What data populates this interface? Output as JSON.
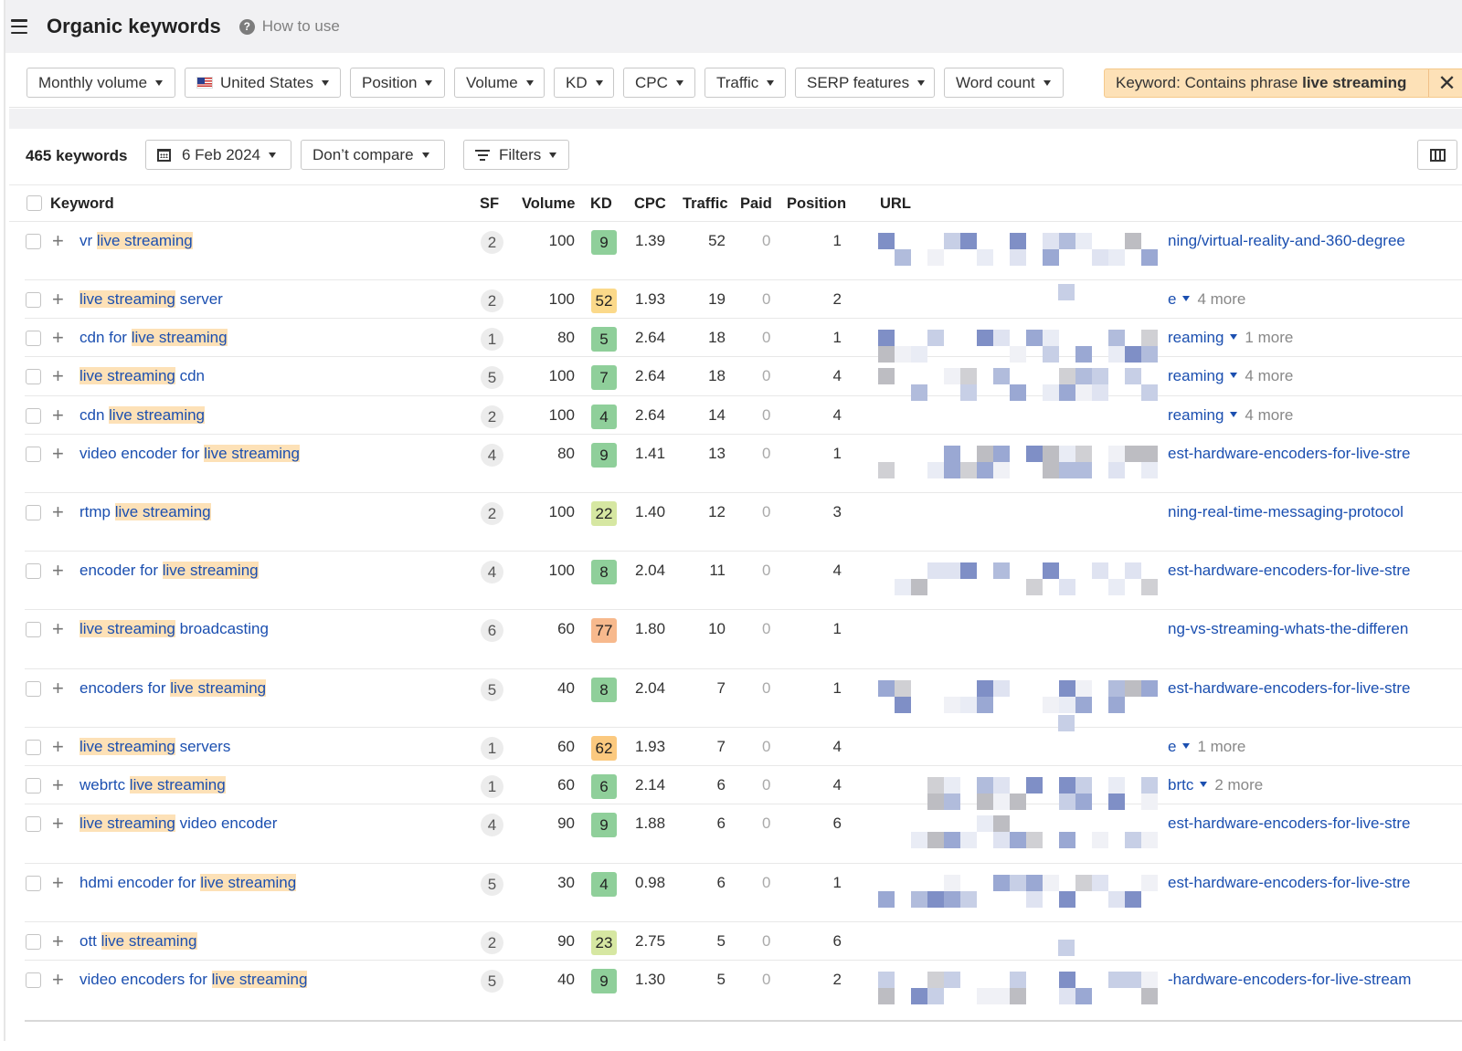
{
  "header": {
    "title": "Organic keywords",
    "how_to_use": "How to use"
  },
  "filters": {
    "monthly_volume": "Monthly volume",
    "country": "United States",
    "position": "Position",
    "volume": "Volume",
    "kd": "KD",
    "cpc": "CPC",
    "traffic": "Traffic",
    "serp_features": "SERP features",
    "word_count": "Word count",
    "keyword_chip_prefix": "Keyword: Contains phrase ",
    "keyword_chip_value": "live streaming"
  },
  "toolbar": {
    "count": "465 keywords",
    "date": "6 Feb 2024",
    "compare": "Don’t compare",
    "filters": "Filters"
  },
  "table": {
    "headers": {
      "keyword": "Keyword",
      "sf": "SF",
      "volume": "Volume",
      "kd": "KD",
      "cpc": "CPC",
      "traffic": "Traffic",
      "paid": "Paid",
      "position": "Position",
      "url": "URL"
    },
    "rows": [
      {
        "pre": "vr ",
        "hl": "live streaming",
        "post": "",
        "sf": "2",
        "volume": "100",
        "kd": "9",
        "kd_color": "#8fcf9a",
        "cpc": "1.39",
        "traffic": "52",
        "paid": "0",
        "position": "1",
        "url": "ning/virtual-reality-and-360-degree",
        "url_dd": false,
        "more": ""
      },
      {
        "pre": "",
        "hl": "live streaming",
        "post": " server",
        "sf": "2",
        "volume": "100",
        "kd": "52",
        "kd_color": "#fbd98a",
        "cpc": "1.93",
        "traffic": "19",
        "paid": "0",
        "position": "2",
        "url": "e",
        "url_dd": true,
        "more": "4 more"
      },
      {
        "pre": "cdn for ",
        "hl": "live streaming",
        "post": "",
        "sf": "1",
        "volume": "80",
        "kd": "5",
        "kd_color": "#8fcf9a",
        "cpc": "2.64",
        "traffic": "18",
        "paid": "0",
        "position": "1",
        "url": "reaming",
        "url_dd": true,
        "more": "1 more"
      },
      {
        "pre": "",
        "hl": "live streaming",
        "post": " cdn",
        "sf": "5",
        "volume": "100",
        "kd": "7",
        "kd_color": "#8fcf9a",
        "cpc": "2.64",
        "traffic": "18",
        "paid": "0",
        "position": "4",
        "url": "reaming",
        "url_dd": true,
        "more": "4 more"
      },
      {
        "pre": "cdn ",
        "hl": "live streaming",
        "post": "",
        "sf": "2",
        "volume": "100",
        "kd": "4",
        "kd_color": "#8fcf9a",
        "cpc": "2.64",
        "traffic": "14",
        "paid": "0",
        "position": "4",
        "url": "reaming",
        "url_dd": true,
        "more": "4 more"
      },
      {
        "pre": "video encoder for ",
        "hl": "live streaming",
        "post": "",
        "sf": "4",
        "volume": "80",
        "kd": "9",
        "kd_color": "#8fcf9a",
        "cpc": "1.41",
        "traffic": "13",
        "paid": "0",
        "position": "1",
        "url": "est-hardware-encoders-for-live-stre",
        "url_dd": false,
        "more": ""
      },
      {
        "pre": "rtmp ",
        "hl": "live streaming",
        "post": "",
        "sf": "2",
        "volume": "100",
        "kd": "22",
        "kd_color": "#d6e7a2",
        "cpc": "1.40",
        "traffic": "12",
        "paid": "0",
        "position": "3",
        "url": "ning-real-time-messaging-protocol",
        "url_dd": false,
        "more": ""
      },
      {
        "pre": "encoder for ",
        "hl": "live streaming",
        "post": "",
        "sf": "4",
        "volume": "100",
        "kd": "8",
        "kd_color": "#8fcf9a",
        "cpc": "2.04",
        "traffic": "11",
        "paid": "0",
        "position": "4",
        "url": "est-hardware-encoders-for-live-stre",
        "url_dd": false,
        "more": ""
      },
      {
        "pre": "",
        "hl": "live streaming",
        "post": " broadcasting",
        "sf": "6",
        "volume": "60",
        "kd": "77",
        "kd_color": "#f7b98d",
        "cpc": "1.80",
        "traffic": "10",
        "paid": "0",
        "position": "1",
        "url": "ng-vs-streaming-whats-the-differen",
        "url_dd": false,
        "more": ""
      },
      {
        "pre": "encoders for ",
        "hl": "live streaming",
        "post": "",
        "sf": "5",
        "volume": "40",
        "kd": "8",
        "kd_color": "#8fcf9a",
        "cpc": "2.04",
        "traffic": "7",
        "paid": "0",
        "position": "1",
        "url": "est-hardware-encoders-for-live-stre",
        "url_dd": false,
        "more": ""
      },
      {
        "pre": "",
        "hl": "live streaming",
        "post": " servers",
        "sf": "1",
        "volume": "60",
        "kd": "62",
        "kd_color": "#fbc97f",
        "cpc": "1.93",
        "traffic": "7",
        "paid": "0",
        "position": "4",
        "url": "e",
        "url_dd": true,
        "more": "1 more"
      },
      {
        "pre": "webrtc ",
        "hl": "live streaming",
        "post": "",
        "sf": "1",
        "volume": "60",
        "kd": "6",
        "kd_color": "#8fcf9a",
        "cpc": "2.14",
        "traffic": "6",
        "paid": "0",
        "position": "4",
        "url": "brtc",
        "url_dd": true,
        "more": "2 more"
      },
      {
        "pre": "",
        "hl": "live streaming",
        "post": " video encoder",
        "sf": "4",
        "volume": "90",
        "kd": "9",
        "kd_color": "#8fcf9a",
        "cpc": "1.88",
        "traffic": "6",
        "paid": "0",
        "position": "6",
        "url": "est-hardware-encoders-for-live-stre",
        "url_dd": false,
        "more": ""
      },
      {
        "pre": "hdmi encoder for ",
        "hl": "live streaming",
        "post": "",
        "sf": "5",
        "volume": "30",
        "kd": "4",
        "kd_color": "#8fcf9a",
        "cpc": "0.98",
        "traffic": "6",
        "paid": "0",
        "position": "1",
        "url": "est-hardware-encoders-for-live-stre",
        "url_dd": false,
        "more": ""
      },
      {
        "pre": "ott ",
        "hl": "live streaming",
        "post": "",
        "sf": "2",
        "volume": "90",
        "kd": "23",
        "kd_color": "#d6e7a2",
        "cpc": "2.75",
        "traffic": "5",
        "paid": "0",
        "position": "6",
        "url": "",
        "url_dd": false,
        "more": ""
      },
      {
        "pre": "video encoders for ",
        "hl": "live streaming",
        "post": "",
        "sf": "5",
        "volume": "40",
        "kd": "9",
        "kd_color": "#8fcf9a",
        "cpc": "1.30",
        "traffic": "5",
        "paid": "0",
        "position": "2",
        "url": "-hardware-encoders-for-live-stream",
        "url_dd": false,
        "more": ""
      }
    ]
  }
}
